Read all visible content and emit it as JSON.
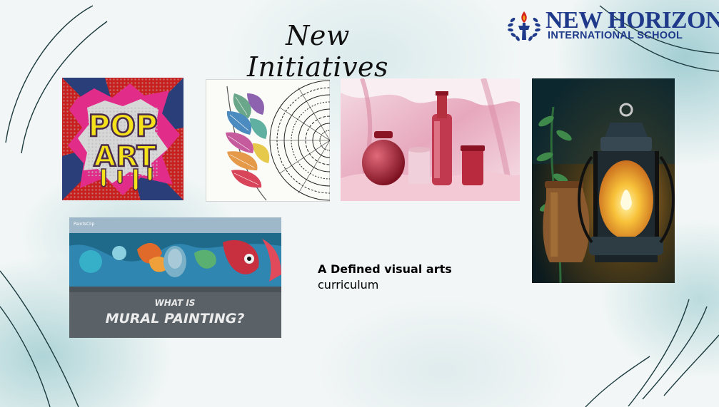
{
  "slide": {
    "title": "New Initiatives",
    "caption_bold": "A Defined visual arts",
    "caption_normal": "curriculum"
  },
  "logo": {
    "name": "NEW HORIZON",
    "subtitle": "INTERNATIONAL SCHOOL"
  },
  "artworks": {
    "pop_art_text_1": "POP",
    "pop_art_text_2": "ART",
    "mural_text_1": "WHAT IS",
    "mural_text_2": "MURAL PAINTING?",
    "mural_watermark": "PaintsClip"
  },
  "colors": {
    "logo_blue": "#1f3a8a",
    "accent_teal": "#7fb9bd",
    "deco_line": "#1b3a3e"
  }
}
